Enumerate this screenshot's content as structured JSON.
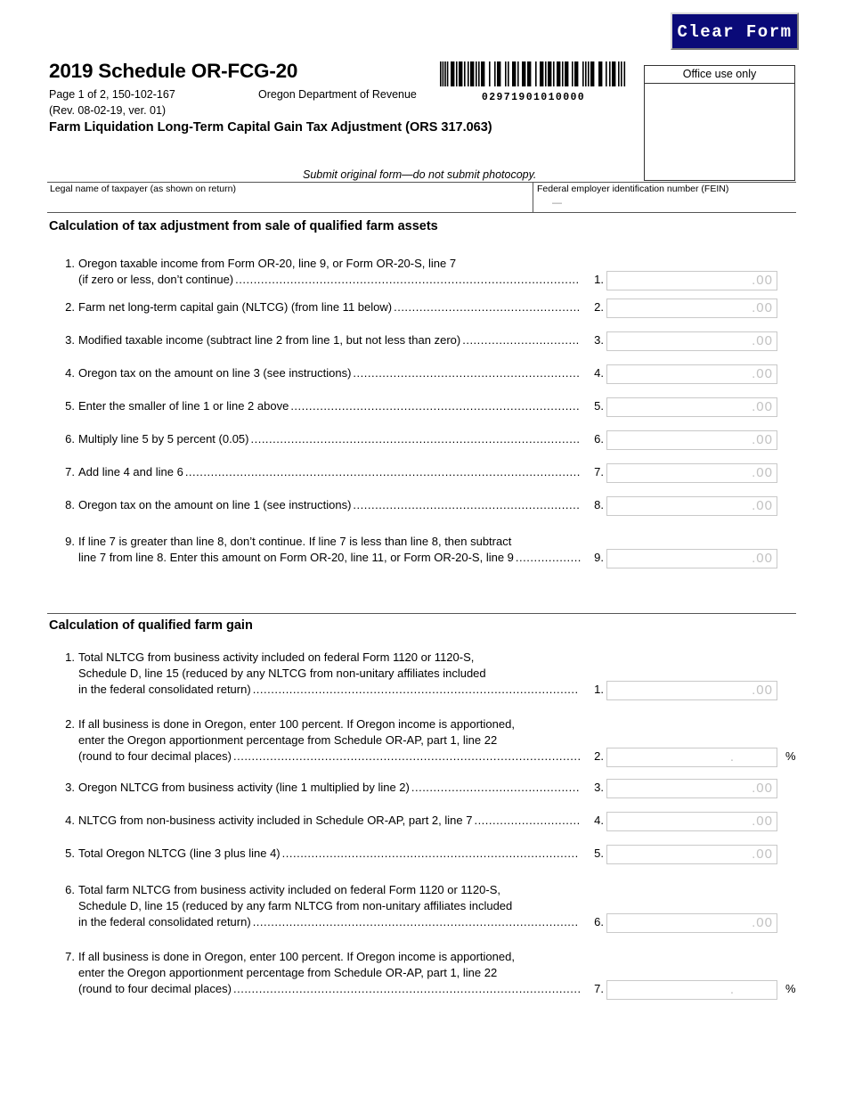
{
  "header": {
    "clear_form_label": "Clear Form",
    "form_title": "2019 Schedule OR-FCG-20",
    "page_info": "Page 1 of 2, 150-102-167",
    "revision": "(Rev. 08-02-19, ver. 01)",
    "department": "Oregon Department of Revenue",
    "subtitle": "Farm Liquidation Long-Term Capital Gain Tax Adjustment (ORS 317.063)",
    "submit_note": "Submit original form—do not submit photocopy.",
    "barcode_number": "02971901010000",
    "office_use_label": "Office use only"
  },
  "taxpayer": {
    "name_label": "Legal name of taxpayer (as shown on return)",
    "name_value": "",
    "fein_label": "Federal employer identification number (FEIN)",
    "fein_value": "—"
  },
  "section1": {
    "heading": "Calculation of tax adjustment from sale of qualified farm assets",
    "lines": [
      {
        "number": "1.",
        "text_line1": "Oregon taxable income from Form OR-20, line 9, or Form OR-20-S, line 7",
        "text_line2": "(if zero or less, don’t continue)",
        "end_number": "1.",
        "field_value": "",
        "field_suffix": ".00"
      },
      {
        "number": "2.",
        "text_line1": "Farm net long-term capital gain (NLTCG) (from line 11 below)",
        "text_line2": "",
        "end_number": "2.",
        "field_value": "",
        "field_suffix": ".00"
      },
      {
        "number": "3.",
        "text_line1": "Modified taxable income (subtract line 2 from line 1, but not less than zero)",
        "text_line2": "",
        "end_number": "3.",
        "field_value": "",
        "field_suffix": ".00"
      },
      {
        "number": "4.",
        "text_line1": "Oregon tax on the amount on line 3 (see instructions)",
        "text_line2": "",
        "end_number": "4.",
        "field_value": "",
        "field_suffix": ".00"
      },
      {
        "number": "5.",
        "text_line1": "Enter the smaller of line 1 or line 2 above",
        "text_line2": "",
        "end_number": "5.",
        "field_value": "",
        "field_suffix": ".00"
      },
      {
        "number": "6.",
        "text_line1": "Multiply line 5 by 5 percent (0.05)",
        "text_line2": "",
        "end_number": "6.",
        "field_value": "",
        "field_suffix": ".00"
      },
      {
        "number": "7.",
        "text_line1": "Add line 4 and line 6",
        "text_line2": "",
        "end_number": "7.",
        "field_value": "",
        "field_suffix": ".00"
      },
      {
        "number": "8.",
        "text_line1": "Oregon tax on the amount on line 1 (see instructions)",
        "text_line2": "",
        "end_number": "8.",
        "field_value": "",
        "field_suffix": ".00"
      },
      {
        "number": "9.",
        "text_line1": "If line 7 is greater than line 8, don’t continue. If line 7 is less than line 8, then subtract",
        "text_line2": "line 7 from line 8. Enter this amount on Form OR-20, line 11, or Form OR-20-S, line 9",
        "end_number": "9.",
        "field_value": "",
        "field_suffix": ".00"
      }
    ]
  },
  "section2": {
    "heading": "Calculation of qualified farm gain",
    "lines": [
      {
        "number": "1.",
        "text_line1": "Total NLTCG from business activity included on federal Form 1120 or 1120-S,",
        "text_line2": "Schedule D, line 15 (reduced by any NLTCG from non-unitary affiliates included",
        "text_line3": "in the federal consolidated return)",
        "end_number": "1.",
        "field_value": "",
        "field_suffix": ".00",
        "field_type": "money"
      },
      {
        "number": "2.",
        "text_line1": "If all business is done in Oregon, enter 100 percent. If Oregon income is apportioned,",
        "text_line2": "enter the Oregon apportionment percentage from Schedule OR-AP, part 1, line 22",
        "text_line3": "(round to four decimal places)",
        "end_number": "2.",
        "field_value": "",
        "field_suffix": ".",
        "field_type": "percent",
        "percent_sign": "%"
      },
      {
        "number": "3.",
        "text_line1": "Oregon NLTCG from business activity (line 1 multiplied by line 2)",
        "text_line2": "",
        "text_line3": "",
        "end_number": "3.",
        "field_value": "",
        "field_suffix": ".00",
        "field_type": "money"
      },
      {
        "number": "4.",
        "text_line1": "NLTCG from non-business activity included in Schedule OR-AP, part 2, line 7",
        "text_line2": "",
        "text_line3": "",
        "end_number": "4.",
        "field_value": "",
        "field_suffix": ".00",
        "field_type": "money"
      },
      {
        "number": "5.",
        "text_line1": "Total Oregon NLTCG (line 3 plus line 4)",
        "text_line2": "",
        "text_line3": "",
        "end_number": "5.",
        "field_value": "",
        "field_suffix": ".00",
        "field_type": "money"
      },
      {
        "number": "6.",
        "text_line1": "Total farm NLTCG from business activity included on federal Form 1120 or 1120-S,",
        "text_line2": "Schedule D, line 15 (reduced by any farm NLTCG from non-unitary affiliates included",
        "text_line3": "in the federal consolidated return)",
        "end_number": "6.",
        "field_value": "",
        "field_suffix": ".00",
        "field_type": "money"
      },
      {
        "number": "7.",
        "text_line1": "If all business is done in Oregon, enter 100 percent. If Oregon income is apportioned,",
        "text_line2": "enter the Oregon apportionment percentage from Schedule OR-AP, part 1, line 22",
        "text_line3": "(round to four decimal places)",
        "end_number": "7.",
        "field_value": "",
        "field_suffix": ".",
        "field_type": "percent",
        "percent_sign": "%"
      }
    ]
  },
  "colors": {
    "clear_form_background": "#0a0a78",
    "clear_form_text": "#ffffff",
    "field_border": "#c9c9c9",
    "field_placeholder": "#c2c2c2",
    "rule": "#555555"
  }
}
